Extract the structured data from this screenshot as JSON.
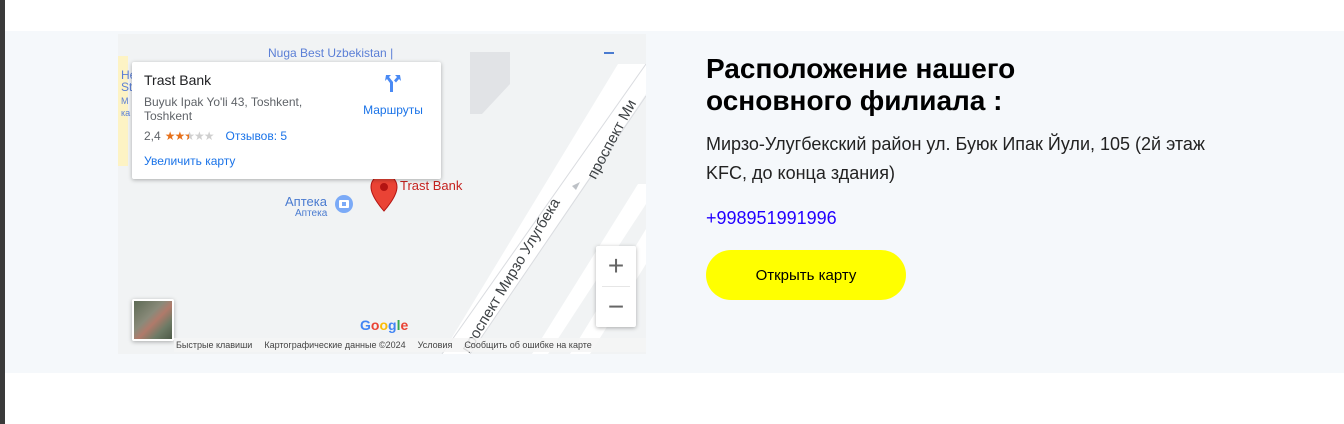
{
  "map": {
    "top_label": "Nuga Best Uzbekistan |",
    "left_cut_label_1": "He",
    "left_cut_label_2": "St",
    "left_cut_label_3": "M",
    "left_cut_label_4": "ка",
    "street_upper": "проспект Ми",
    "street_lower": "проспект Мирзо Улугбека",
    "pin_label": "Trast Bank",
    "pharmacy_title": "Аптека",
    "pharmacy_sub": "Аптека",
    "info": {
      "title": "Trast Bank",
      "address": "Buyuk Ipak Yo'li 43, Toshkent, Toshkent",
      "rating": "2,4",
      "stars_filled": 2.5,
      "reviews": "Отзывов: 5",
      "enlarge": "Увеличить карту",
      "route": "Маршруты"
    },
    "zoom_in": "+",
    "zoom_out": "−",
    "google": "Google",
    "footer": {
      "shortcuts": "Быстрые клавиши",
      "data": "Картографические данные ©2024",
      "terms": "Условия",
      "report": "Сообщить об ошибке на карте"
    }
  },
  "content": {
    "heading": "Расположение нашего основного филиала :",
    "address": "Мирзо-Улугбекский район ул. Буюк Ипак Йули, 105 (2й этаж KFC, до конца здания)",
    "phone": "+998951991996",
    "button": "Открыть карту"
  },
  "colors": {
    "accent_button": "#ffff00",
    "phone_link": "#2200ff",
    "map_link": "#1a73e8",
    "pin": "#ea4335"
  }
}
